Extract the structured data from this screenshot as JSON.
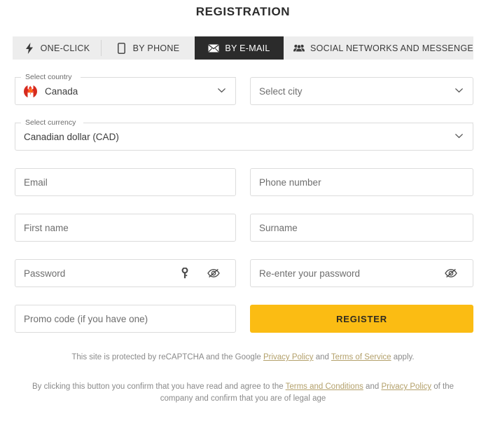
{
  "header": {
    "title": "REGISTRATION"
  },
  "tabs": [
    {
      "label": "ONE-CLICK",
      "icon": "lightning-bolt-icon",
      "active": false
    },
    {
      "label": "BY PHONE",
      "icon": "mobile-phone-icon",
      "active": false
    },
    {
      "label": "BY E-MAIL",
      "icon": "envelope-icon",
      "active": true
    },
    {
      "label": "SOCIAL NETWORKS AND MESSENGERS",
      "icon": "people-group-icon",
      "active": false
    }
  ],
  "form": {
    "country": {
      "legend": "Select country",
      "value": "Canada",
      "flag": "canada-flag-icon",
      "chevron": "chevron-down-icon"
    },
    "city": {
      "placeholder": "Select city",
      "value": "",
      "chevron": "chevron-down-icon"
    },
    "currency": {
      "legend": "Select currency",
      "value": "Canadian dollar (CAD)",
      "chevron": "chevron-down-icon"
    },
    "email": {
      "placeholder": "Email",
      "value": ""
    },
    "phone": {
      "placeholder": "Phone number",
      "value": ""
    },
    "first_name": {
      "placeholder": "First name",
      "value": ""
    },
    "surname": {
      "placeholder": "Surname",
      "value": ""
    },
    "password": {
      "placeholder": "Password",
      "value": "",
      "key_icon": "key-icon",
      "eye_icon": "eye-off-icon"
    },
    "confirm_password": {
      "placeholder": "Re-enter your password",
      "value": "",
      "eye_icon": "eye-off-icon"
    },
    "promo": {
      "placeholder": "Promo code (if you have one)",
      "value": ""
    },
    "submit": {
      "label": "REGISTER"
    }
  },
  "legal": {
    "recaptcha": {
      "prefix": "This site is protected by reCAPTCHA and the Google ",
      "link1": "Privacy Policy",
      "middle": " and ",
      "link2": "Terms of Service",
      "suffix": " apply."
    },
    "terms": {
      "prefix": "By clicking this button you confirm that you have read and agree to the ",
      "link1": "Terms and Conditions",
      "middle": " and ",
      "link2": "Privacy Policy",
      "suffix": " of the company and confirm that you are of legal age"
    }
  },
  "colors": {
    "accent": "#fbbc13",
    "active_tab_bg": "#2b2b2b",
    "tabbar_bg": "#ededed",
    "link": "#b3a06a",
    "flag_red": "#d52b1e"
  }
}
